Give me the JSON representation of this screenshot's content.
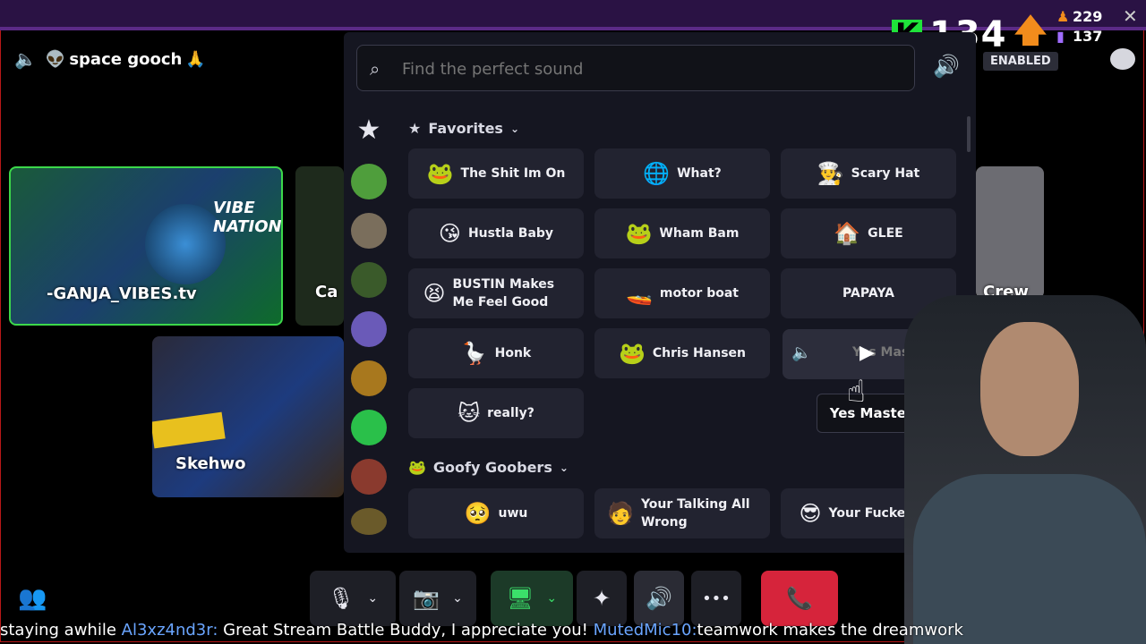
{
  "kick": {
    "logo": "K",
    "viewers": "134",
    "arrow": "🡅"
  },
  "stats": {
    "followers": "229",
    "subs": "137",
    "close": "✕"
  },
  "user": {
    "name": "space gooch",
    "emoji_left": "👽",
    "emoji_right": "🙏"
  },
  "tiles": {
    "ganja": "-GANJA_VIBES.tv",
    "ca": "Ca",
    "skehwo": "Skehwo",
    "crew": "Crew"
  },
  "picker": {
    "search_placeholder": "Find the perfect sound",
    "enabled_label": "ENABLED",
    "favorites_label": "Favorites",
    "goofy_label": "Goofy Goobers",
    "favorites": [
      {
        "label": "The Shit Im On",
        "icon": "🐸"
      },
      {
        "label": "What?",
        "icon": "🌐"
      },
      {
        "label": "Scary Hat",
        "icon": "👨‍🍳"
      },
      {
        "label": "Hustla Baby",
        "icon": "😘"
      },
      {
        "label": "Wham Bam",
        "icon": "🐸"
      },
      {
        "label": "GLEE",
        "icon": "🏠"
      },
      {
        "label": "BUSTIN Makes Me Feel Good",
        "icon": "😫"
      },
      {
        "label": "motor boat",
        "icon": "🚤"
      },
      {
        "label": "PAPAYA",
        "icon": ""
      },
      {
        "label": "Honk",
        "icon": "🪿"
      },
      {
        "label": "Chris Hansen",
        "icon": "🐸"
      },
      {
        "label": "Yes Master",
        "icon": ""
      },
      {
        "label": "really?",
        "icon": "🐱"
      }
    ],
    "goofy": [
      {
        "label": "uwu",
        "icon": "🥺"
      },
      {
        "label": "Your Talking All Wrong",
        "icon": "🧑"
      },
      {
        "label": "Your Fucked Up",
        "icon": "😎"
      }
    ],
    "tooltip": "Yes Master",
    "hover_preview_label": "Yes Master"
  },
  "toolbar": {
    "mic": "🎙",
    "camera": "📷",
    "share": "🖥",
    "activities": "✦",
    "soundboard": "🔊",
    "more": "•••",
    "hangup": "📞"
  },
  "ticker": {
    "part1": "staying awhile",
    "user1": "Al3xz4nd3r:",
    "msg1": "Great Stream Battle Buddy, I appreciate you!",
    "user2": "MutedMic10:",
    "msg2": "teamwork makes the dreamwork"
  }
}
